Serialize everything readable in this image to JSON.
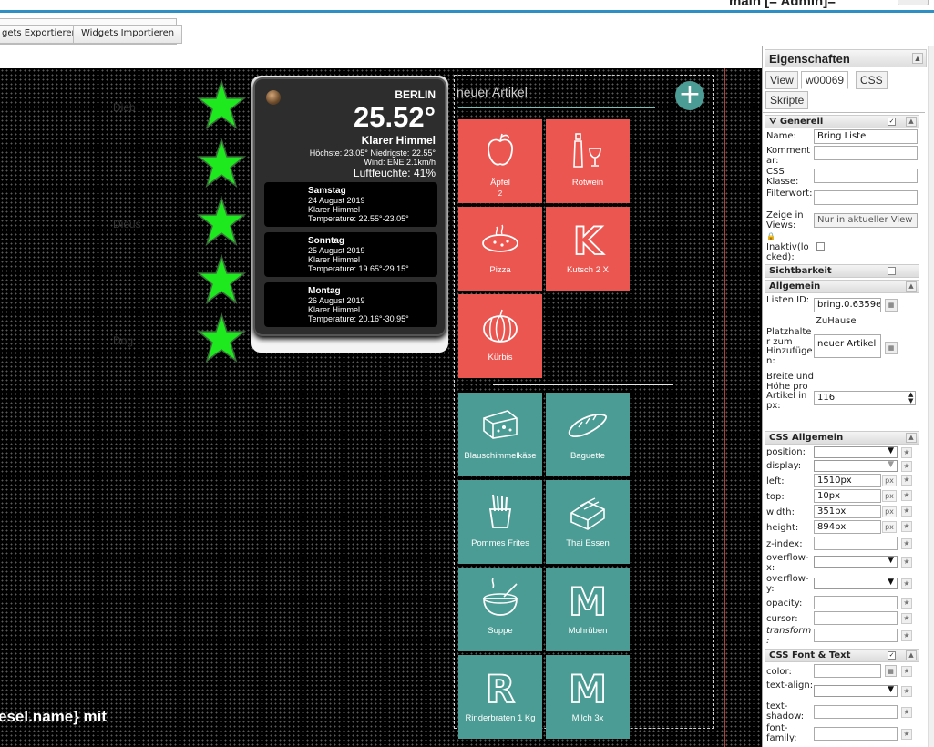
{
  "app": {
    "title": "main [= Admin]="
  },
  "toolbar": {
    "export_label": "gets Exportieren",
    "import_label": "Widgets Importieren"
  },
  "canvas": {
    "dim_labels": [
      "Dieb",
      "",
      "Dieus",
      "",
      "Dog"
    ],
    "bottom_text": "esel.name} mit"
  },
  "weather": {
    "city": "BERLIN",
    "temperature": "25.52°",
    "condition": "Klarer Himmel",
    "minmax": "Höchste: 23.05° Niedrigste: 22.55°",
    "wind": "Wind: ENE 2.1km/h",
    "humidity": "Luftfeuchte: 41%",
    "forecast": [
      {
        "day": "Samstag",
        "date": "24 August 2019",
        "cond": "Klarer Himmel",
        "temp": "Temperature: 22.55°-23.05°"
      },
      {
        "day": "Sonntag",
        "date": "25 August 2019",
        "cond": "Klarer Himmel",
        "temp": "Temperature: 19.65°-29.15°"
      },
      {
        "day": "Montag",
        "date": "26 August 2019",
        "cond": "Klarer Himmel",
        "temp": "Temperature: 20.16°-30.95°"
      }
    ]
  },
  "bring": {
    "placeholder": "neuer Artikel",
    "add_icon": "+",
    "active_items": [
      {
        "name": "Äpfel",
        "spec": "2",
        "icon": "apple-icon"
      },
      {
        "name": "Rotwein",
        "spec": "",
        "icon": "wine-icon"
      },
      {
        "name": "Pizza",
        "spec": "",
        "icon": "pizza-icon"
      },
      {
        "name": "Kutsch 2 X",
        "spec": "",
        "icon": "letter-k-icon",
        "letter": "K"
      },
      {
        "name": "Kürbis",
        "spec": "",
        "icon": "pumpkin-icon"
      }
    ],
    "recent_items": [
      {
        "name": "Blauschimmelkäse",
        "icon": "cheese-icon"
      },
      {
        "name": "Baguette",
        "icon": "baguette-icon"
      },
      {
        "name": "Pommes Frites",
        "icon": "fries-icon"
      },
      {
        "name": "Thai Essen",
        "icon": "takeaway-icon"
      },
      {
        "name": "Suppe",
        "icon": "soup-icon"
      },
      {
        "name": "Mohrüben",
        "icon": "letter-m-icon",
        "letter": "M"
      },
      {
        "name": "Rinderbraten 1 Kg",
        "icon": "letter-r-icon",
        "letter": "R"
      },
      {
        "name": "Milch 3x",
        "icon": "letter-m-icon",
        "letter": "M"
      }
    ]
  },
  "panel": {
    "title": "Eigenschaften",
    "tabs": [
      "View",
      "w00069",
      "CSS",
      "Skripte"
    ],
    "sections": {
      "general": "Generell",
      "visibility": "Sichtbarkeit",
      "common": "Allgemein",
      "css_common": "CSS Allgemein",
      "css_font": "CSS Font & Text"
    },
    "fields": {
      "name_label": "Name:",
      "name_value": "Bring Liste",
      "comment_label": "Kommentar:",
      "css_class_label": "CSS Klasse:",
      "filter_label": "Filterwort:",
      "views_label": "Zeige in Views:",
      "views_value": "Nur in aktueller View",
      "inactive_label": "Inaktiv(locked):",
      "list_id_label": "Listen ID:",
      "list_id_value": "bring.0.6359e",
      "list_name": "ZuHause",
      "placeholder_label": "Platzhalter zum Hinzufügen:",
      "placeholder_value": "neuer Artikel",
      "size_label": "Breite und Höhe pro Artikel in px:",
      "size_value": "116"
    },
    "css": {
      "position": "position:",
      "display": "display:",
      "left": "left:",
      "left_value": "1510px",
      "top": "top:",
      "top_value": "10px",
      "width": "width:",
      "width_value": "351px",
      "height": "height:",
      "height_value": "894px",
      "zindex": "z-index:",
      "overflowx": "overflow-x:",
      "overflowy": "overflow-y:",
      "opacity": "opacity:",
      "cursor": "cursor:",
      "transform": "transform:",
      "px": "px",
      "color": "color:",
      "textalign": "text-align:",
      "textshadow": "text-shadow:",
      "fontfamily": "font-family:"
    }
  },
  "colors": {
    "accent": "#2e8fc4",
    "tile_red": "#ec5650",
    "tile_green": "#4a9c94",
    "star": "#1ee81e"
  }
}
